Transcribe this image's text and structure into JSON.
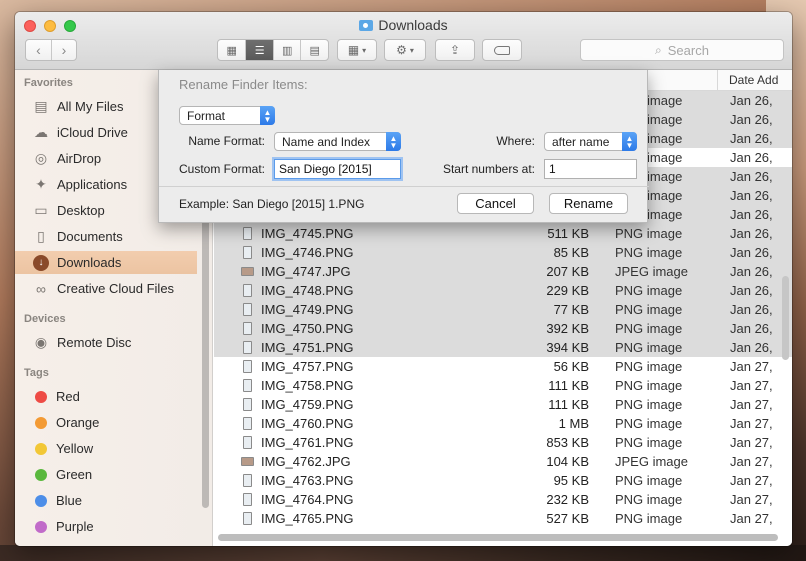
{
  "window": {
    "title": "Downloads"
  },
  "toolbar": {
    "back_icon": "chevron-left-icon",
    "forward_icon": "chevron-right-icon",
    "search_placeholder": "Search"
  },
  "sidebar": {
    "favorites_header": "Favorites",
    "favorites": [
      {
        "label": "All My Files",
        "icon": "all-files-icon"
      },
      {
        "label": "iCloud Drive",
        "icon": "cloud-icon"
      },
      {
        "label": "AirDrop",
        "icon": "airdrop-icon"
      },
      {
        "label": "Applications",
        "icon": "applications-icon"
      },
      {
        "label": "Desktop",
        "icon": "desktop-icon"
      },
      {
        "label": "Documents",
        "icon": "documents-icon"
      },
      {
        "label": "Downloads",
        "icon": "downloads-icon",
        "selected": true
      },
      {
        "label": "Creative Cloud Files",
        "icon": "creative-cloud-icon"
      }
    ],
    "devices_header": "Devices",
    "devices": [
      {
        "label": "Remote Disc",
        "icon": "disc-icon"
      }
    ],
    "tags_header": "Tags",
    "tags": [
      {
        "label": "Red",
        "color": "#ee4b45"
      },
      {
        "label": "Orange",
        "color": "#f39a34"
      },
      {
        "label": "Yellow",
        "color": "#f2c736"
      },
      {
        "label": "Green",
        "color": "#5ab83d"
      },
      {
        "label": "Blue",
        "color": "#4d8ee8"
      },
      {
        "label": "Purple",
        "color": "#c16bc9"
      }
    ]
  },
  "list": {
    "date_header": "Date Add",
    "hidden_rows": [
      {
        "kind": "image",
        "date": "Jan 26,"
      },
      {
        "kind": "image",
        "date": "Jan 26,"
      },
      {
        "kind": "image",
        "date": "Jan 26,"
      },
      {
        "kind": "image",
        "date": "Jan 26,"
      },
      {
        "kind": "image",
        "date": "Jan 26,"
      },
      {
        "kind": "image",
        "date": "Jan 26,"
      },
      {
        "kind": "image",
        "date": "Jan 26,"
      }
    ],
    "rows": [
      {
        "name": "IMG_4745.PNG",
        "size": "511 KB",
        "kind": "PNG image",
        "date": "Jan 26,",
        "type": "png",
        "selected": true
      },
      {
        "name": "IMG_4746.PNG",
        "size": "85 KB",
        "kind": "PNG image",
        "date": "Jan 26,",
        "type": "png",
        "selected": true
      },
      {
        "name": "IMG_4747.JPG",
        "size": "207 KB",
        "kind": "JPEG image",
        "date": "Jan 26,",
        "type": "jpg",
        "selected": true
      },
      {
        "name": "IMG_4748.PNG",
        "size": "229 KB",
        "kind": "PNG image",
        "date": "Jan 26,",
        "type": "png",
        "selected": true
      },
      {
        "name": "IMG_4749.PNG",
        "size": "77 KB",
        "kind": "PNG image",
        "date": "Jan 26,",
        "type": "png",
        "selected": true
      },
      {
        "name": "IMG_4750.PNG",
        "size": "392 KB",
        "kind": "PNG image",
        "date": "Jan 26,",
        "type": "png",
        "selected": true
      },
      {
        "name": "IMG_4751.PNG",
        "size": "394 KB",
        "kind": "PNG image",
        "date": "Jan 26,",
        "type": "png",
        "selected": true
      },
      {
        "name": "IMG_4757.PNG",
        "size": "56 KB",
        "kind": "PNG image",
        "date": "Jan 27,",
        "type": "png",
        "selected": false
      },
      {
        "name": "IMG_4758.PNG",
        "size": "111 KB",
        "kind": "PNG image",
        "date": "Jan 27,",
        "type": "png",
        "selected": false
      },
      {
        "name": "IMG_4759.PNG",
        "size": "111 KB",
        "kind": "PNG image",
        "date": "Jan 27,",
        "type": "png",
        "selected": false
      },
      {
        "name": "IMG_4760.PNG",
        "size": "1 MB",
        "kind": "PNG image",
        "date": "Jan 27,",
        "type": "png",
        "selected": false
      },
      {
        "name": "IMG_4761.PNG",
        "size": "853 KB",
        "kind": "PNG image",
        "date": "Jan 27,",
        "type": "png",
        "selected": false
      },
      {
        "name": "IMG_4762.JPG",
        "size": "104 KB",
        "kind": "JPEG image",
        "date": "Jan 27,",
        "type": "jpg",
        "selected": false
      },
      {
        "name": "IMG_4763.PNG",
        "size": "95 KB",
        "kind": "PNG image",
        "date": "Jan 27,",
        "type": "png",
        "selected": false
      },
      {
        "name": "IMG_4764.PNG",
        "size": "232 KB",
        "kind": "PNG image",
        "date": "Jan 27,",
        "type": "png",
        "selected": false
      },
      {
        "name": "IMG_4765.PNG",
        "size": "527 KB",
        "kind": "PNG image",
        "date": "Jan 27,",
        "type": "png",
        "selected": false
      }
    ]
  },
  "rename_sheet": {
    "title": "Rename Finder Items:",
    "mode": "Format",
    "name_format_label": "Name Format:",
    "name_format_value": "Name and Index",
    "where_label": "Where:",
    "where_value": "after name",
    "custom_format_label": "Custom Format:",
    "custom_format_value": "San Diego [2015]",
    "start_numbers_label": "Start numbers at:",
    "start_numbers_value": "1",
    "example_text": "Example: San Diego [2015] 1.PNG",
    "cancel_label": "Cancel",
    "rename_label": "Rename"
  }
}
